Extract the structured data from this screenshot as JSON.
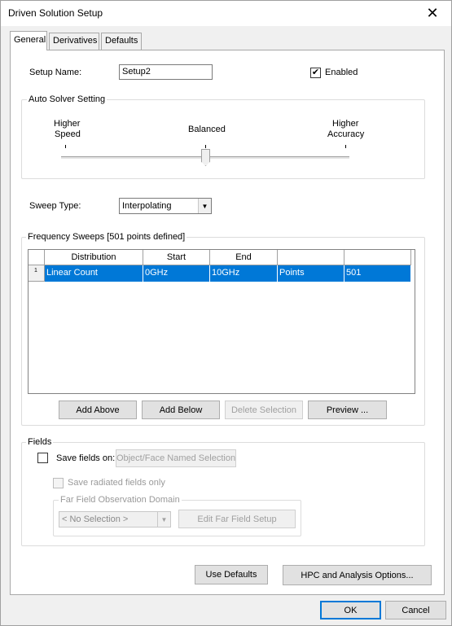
{
  "window": {
    "title": "Driven Solution Setup",
    "close_glyph": "✕"
  },
  "tabs": [
    {
      "label": "General",
      "active": true
    },
    {
      "label": "Derivatives",
      "active": false
    },
    {
      "label": "Defaults",
      "active": false
    }
  ],
  "setup": {
    "name_label": "Setup Name:",
    "name_value": "Setup2",
    "enabled_label": "Enabled",
    "enabled_checked": true,
    "check_glyph": "✔"
  },
  "auto_solver": {
    "title": "Auto Solver Setting",
    "left_label_1": "Higher",
    "left_label_2": "Speed",
    "center_label": "Balanced",
    "right_label_1": "Higher",
    "right_label_2": "Accuracy",
    "level": 0.5
  },
  "sweep": {
    "label": "Sweep Type:",
    "value": "Interpolating"
  },
  "freq_sweeps": {
    "title": "Frequency Sweeps [501 points defined]",
    "columns": [
      "Distribution",
      "Start",
      "End",
      "",
      ""
    ],
    "rows": [
      {
        "num": "1",
        "cells": [
          "Linear Count",
          "0GHz",
          "10GHz",
          "Points",
          "501"
        ],
        "selected": true
      }
    ],
    "buttons": {
      "add_above": "Add Above",
      "add_below": "Add Below",
      "delete": "Delete Selection",
      "preview": "Preview ..."
    }
  },
  "fields": {
    "title": "Fields",
    "save_label": "Save fields on:",
    "save_checked": false,
    "named_selection_button": "Object/Face Named Selection",
    "save_radiated_label": "Save radiated fields only",
    "far_field_title": "Far Field Observation Domain",
    "far_field_select": "< No Selection >",
    "edit_far_field_button": "Edit Far Field Setup"
  },
  "panel_buttons": {
    "use_defaults": "Use Defaults",
    "hpc": "HPC and Analysis Options..."
  },
  "footer": {
    "ok": "OK",
    "cancel": "Cancel"
  },
  "colors": {
    "selection": "#0078d7",
    "default_border": "#0078d7"
  }
}
